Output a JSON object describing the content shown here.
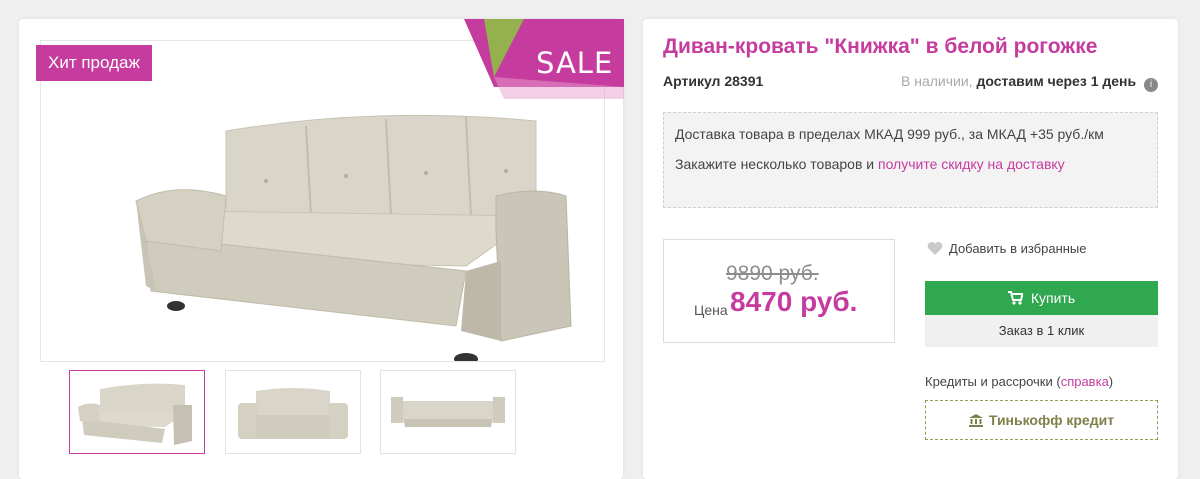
{
  "gallery": {
    "hit_badge": "Хит продаж",
    "sale_label": "SALE",
    "thumbnails": [
      {
        "alt": "sofa-angle",
        "active": true
      },
      {
        "alt": "sofa-front",
        "active": false
      },
      {
        "alt": "sofa-unfolded",
        "active": false
      }
    ]
  },
  "product": {
    "title": "Диван-кровать \"Книжка\" в белой рогожке",
    "sku": "Артикул 28391",
    "stock_status": "В наличии,",
    "delivery_time": "доставим через 1 день",
    "info_icon": "i"
  },
  "delivery": {
    "line1": "Доставка товара в пределах МКАД 999 руб., за МКАД +35 руб./км",
    "line2_prefix": "Закажите несколько товаров и",
    "line2_link": "получите скидку на доставку"
  },
  "price": {
    "old": "9890 руб.",
    "label": "Цена",
    "current": "8470 руб."
  },
  "actions": {
    "favorite": "Добавить в избранные",
    "buy": "Купить",
    "one_click": "Заказ в 1 клик",
    "credit_prefix": "Кредиты и рассрочки (",
    "credit_link": "справка",
    "credit_suffix": ")",
    "tinkoff": "Тинькофф кредит"
  },
  "colors": {
    "accent": "#c53c9e",
    "buy": "#2fa84f",
    "tinkoff": "#7f7f4a"
  },
  "icons": [
    "heart-icon",
    "cart-icon",
    "bank-icon",
    "info-icon"
  ]
}
